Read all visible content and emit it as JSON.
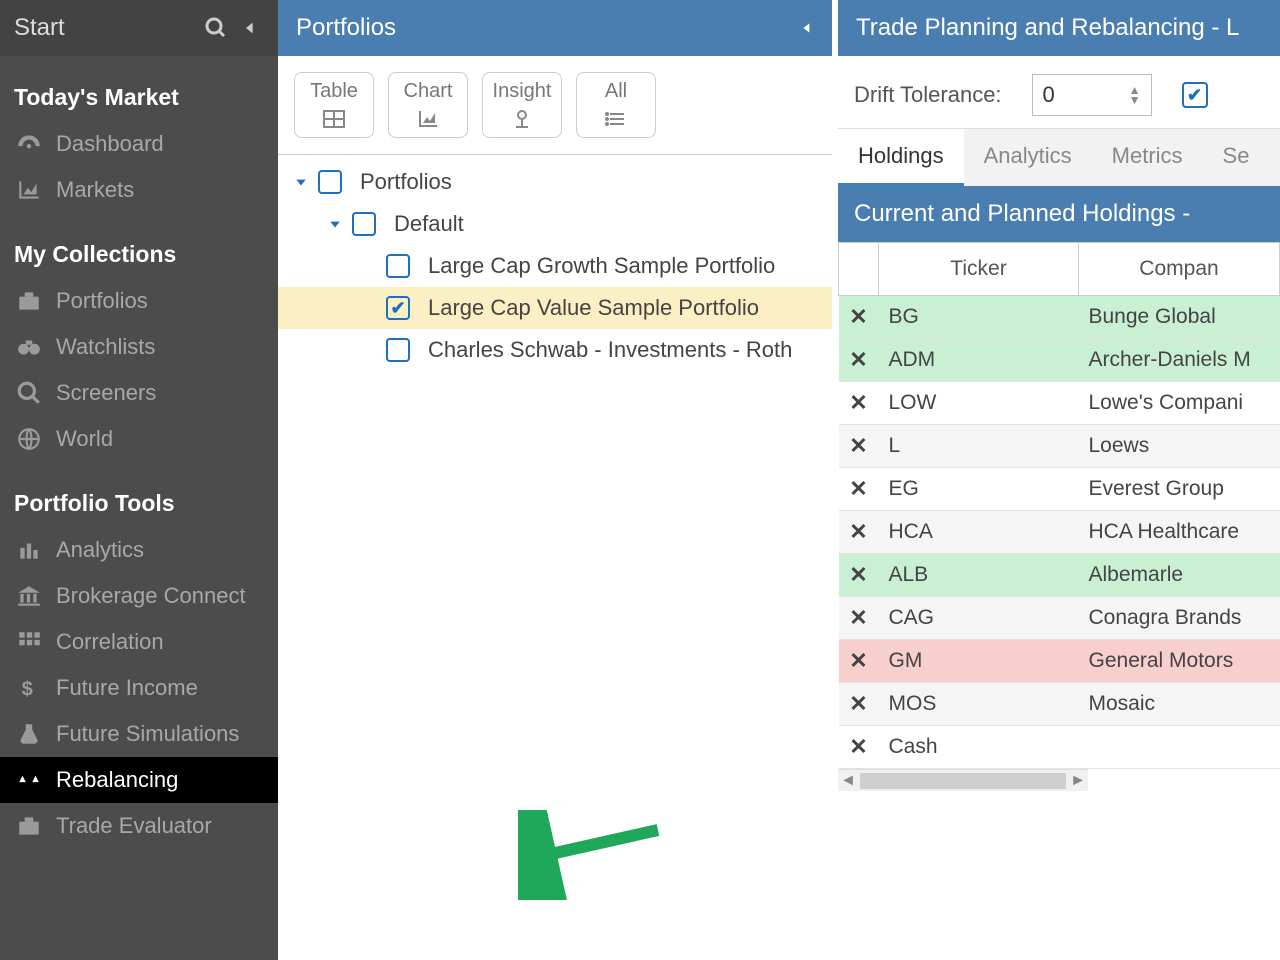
{
  "sidebar": {
    "start": "Start",
    "sections": {
      "today": "Today's Market",
      "collections": "My Collections",
      "tools": "Portfolio Tools"
    },
    "items": {
      "dashboard": "Dashboard",
      "markets": "Markets",
      "portfolios": "Portfolios",
      "watchlists": "Watchlists",
      "screeners": "Screeners",
      "world": "World",
      "analytics": "Analytics",
      "brokerage": "Brokerage Connect",
      "correlation": "Correlation",
      "future_income": "Future Income",
      "future_sim": "Future Simulations",
      "rebalancing": "Rebalancing",
      "trade_eval": "Trade Evaluator"
    }
  },
  "middle": {
    "title": "Portfolios",
    "views": {
      "table": "Table",
      "chart": "Chart",
      "insight": "Insight",
      "all": "All"
    },
    "tree": {
      "root": "Portfolios",
      "default": "Default",
      "p1": "Large Cap Growth Sample Portfolio",
      "p2": "Large Cap Value Sample Portfolio",
      "p3": "Charles Schwab - Investments - Roth"
    }
  },
  "right": {
    "title": "Trade Planning and Rebalancing - L",
    "drift_label": "Drift Tolerance:",
    "drift_value": "0",
    "tabs": {
      "holdings": "Holdings",
      "analytics": "Analytics",
      "metrics": "Metrics",
      "more": "Se"
    },
    "section": "Current and Planned Holdings -",
    "headers": {
      "ticker": "Ticker",
      "company": "Compan"
    },
    "rows": [
      {
        "t": "BG",
        "c": "Bunge Global",
        "cls": "green"
      },
      {
        "t": "ADM",
        "c": "Archer-Daniels M",
        "cls": "green"
      },
      {
        "t": "LOW",
        "c": "Lowe's Compani",
        "cls": ""
      },
      {
        "t": "L",
        "c": "Loews",
        "cls": "alt"
      },
      {
        "t": "EG",
        "c": "Everest Group",
        "cls": ""
      },
      {
        "t": "HCA",
        "c": "HCA Healthcare",
        "cls": "alt"
      },
      {
        "t": "ALB",
        "c": "Albemarle",
        "cls": "green"
      },
      {
        "t": "CAG",
        "c": "Conagra Brands",
        "cls": "alt"
      },
      {
        "t": "GM",
        "c": "General Motors",
        "cls": "pink"
      },
      {
        "t": "MOS",
        "c": "Mosaic",
        "cls": "alt"
      },
      {
        "t": "Cash",
        "c": "",
        "cls": ""
      }
    ]
  }
}
